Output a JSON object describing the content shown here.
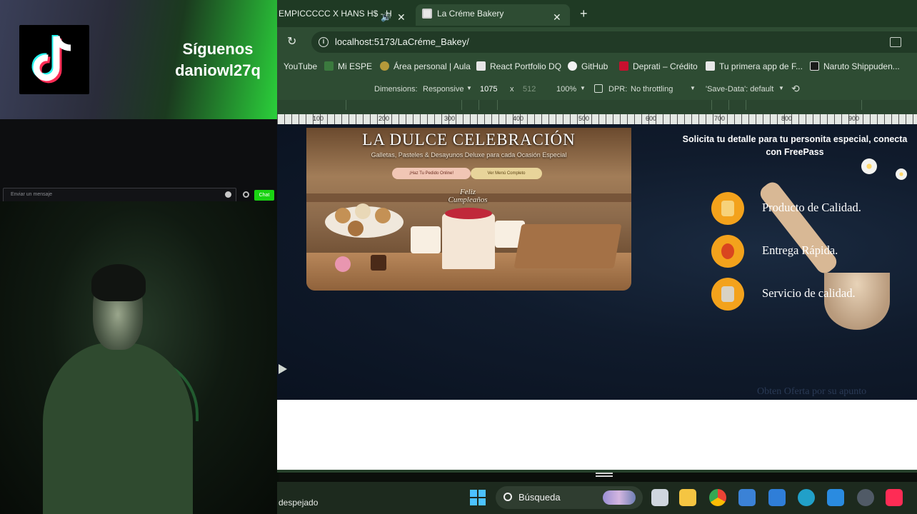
{
  "overlay": {
    "follow_line1": "Síguenos",
    "follow_line2": "daniowl27q",
    "chat_placeholder": "Enviar un mensaje",
    "chat_button": "Chat"
  },
  "browser": {
    "tabs": [
      {
        "label": "EMPICCCCC X HANS H$ - H"
      },
      {
        "label": "La Créme Bakery"
      }
    ],
    "address": "localhost:5173/LaCréme_Bakey/",
    "bookmarks": [
      {
        "label": "YouTube"
      },
      {
        "label": "Mi ESPE"
      },
      {
        "label": "Área personal | Aula"
      },
      {
        "label": "React Portfolio DQ"
      },
      {
        "label": "GitHub"
      },
      {
        "label": "Deprati – Crédito"
      },
      {
        "label": "Tu primera app de F..."
      },
      {
        "label": "Naruto Shippuden..."
      }
    ],
    "devtools": {
      "dimensions_label": "Dimensions:",
      "dimensions_value": "Responsive",
      "width": "1075",
      "times": "x",
      "height": "512",
      "zoom": "100%",
      "dpr": "DPR:",
      "throttling": "No throttling",
      "save_data": "'Save-Data': default"
    },
    "ruler_labels": [
      "100",
      "200",
      "300",
      "400",
      "500",
      "600",
      "700",
      "800",
      "900"
    ]
  },
  "page": {
    "hero_title": "LA DULCE CELEBRACIÓN",
    "hero_subtitle": "Galletas, Pasteles & Desayunos Deluxe para cada Ocasión Especial",
    "hero_button_1": "¡Haz Tu Pedido Online!",
    "hero_button_2": "Ver Menú Completo",
    "cake_text": "Feliz Cumpleaños",
    "promo_line1": "Solicita tu detalle para tu personita especial, conecta",
    "promo_line2": "con FreePass",
    "features": [
      {
        "label": "Producto de Calidad."
      },
      {
        "label": "Entrega Rápida."
      },
      {
        "label": "Servicio de calidad."
      }
    ],
    "faded_text": "Obten Oferta por su apunto"
  },
  "taskbar": {
    "weather": "despejado",
    "search": "Búsqueda"
  },
  "colors": {
    "accent_orange": "#f3a21c",
    "chat_green": "#19d312",
    "page_bg": "#101b2c"
  }
}
